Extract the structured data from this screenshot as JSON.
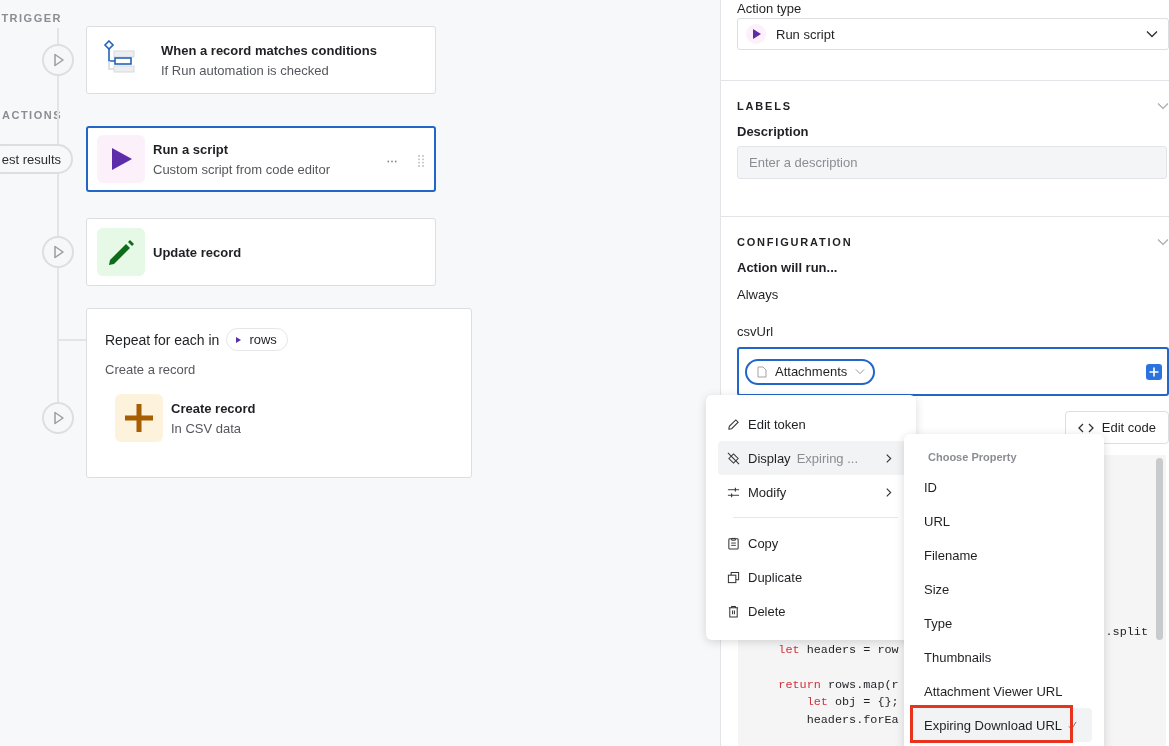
{
  "flow": [
    {
      "kind": "section",
      "label": "TRIGGER"
    },
    {
      "kind": "step",
      "title": "When a record matches conditions",
      "subtitle": "If Run automation is checked",
      "selected": false
    },
    {
      "kind": "section",
      "label": "ACTIONS"
    },
    {
      "kind": "step",
      "title": "Run a script",
      "subtitle": "Custom script from code editor",
      "selected": true,
      "badge": "est results"
    },
    {
      "kind": "step",
      "title": "Update record",
      "selected": false
    },
    {
      "kind": "loop",
      "title": "Repeat for each in",
      "token": "rows",
      "subtitle": "Create a record",
      "step": {
        "title": "Create record",
        "subtitle": "In CSV data"
      }
    }
  ],
  "panel": {
    "action_type": {
      "label": "Action type",
      "value": "Run script"
    },
    "labels": {
      "heading": "LABELS",
      "field_label": "Description",
      "placeholder": "Enter a description"
    },
    "configuration": {
      "heading": "CONFIGURATION",
      "run_label": "Action will run...",
      "run_value": "Always",
      "input_label": "csvUrl",
      "token": "Attachments"
    },
    "edit_code": "Edit code",
    "code_lines": [
      {
        "kind": "tail",
        "tokens": [
          {
            "text": ".split",
            "kind": "plain"
          }
        ]
      },
      {
        "kind": "line",
        "tokens": [
          {
            "text": "    let",
            "kind": "keyword"
          },
          {
            "text": " headers = row",
            "kind": "plain"
          }
        ]
      },
      {
        "kind": "blank"
      },
      {
        "kind": "line",
        "tokens": [
          {
            "text": "    return",
            "kind": "keyword"
          },
          {
            "text": " rows.map(r",
            "kind": "plain"
          }
        ]
      },
      {
        "kind": "line",
        "tokens": [
          {
            "text": "        let",
            "kind": "keyword"
          },
          {
            "text": " obj = {};",
            "kind": "plain"
          }
        ]
      },
      {
        "kind": "line",
        "tokens": [
          {
            "text": "        headers.forEa",
            "kind": "plain"
          }
        ]
      }
    ]
  },
  "context_menu": {
    "items": [
      {
        "kind": "item",
        "label": "Edit token",
        "selected": false
      },
      {
        "kind": "item",
        "label": "Display",
        "value": "Expiring ...",
        "submenu": true,
        "selected": true
      },
      {
        "kind": "item",
        "label": "Modify",
        "submenu": true,
        "selected": false
      },
      {
        "kind": "divider"
      },
      {
        "kind": "item",
        "label": "Copy",
        "selected": false
      },
      {
        "kind": "item",
        "label": "Duplicate",
        "selected": false
      },
      {
        "kind": "item",
        "label": "Delete",
        "selected": false
      }
    ]
  },
  "submenu": {
    "heading": "Choose Property",
    "items": [
      {
        "label": "ID",
        "selected": false
      },
      {
        "label": "URL",
        "selected": false
      },
      {
        "label": "Filename",
        "selected": false
      },
      {
        "label": "Size",
        "selected": false
      },
      {
        "label": "Type",
        "selected": false
      },
      {
        "label": "Thumbnails",
        "selected": false
      },
      {
        "label": "Attachment Viewer URL",
        "selected": false
      },
      {
        "label": "Expiring Download URL",
        "selected": true
      }
    ]
  }
}
